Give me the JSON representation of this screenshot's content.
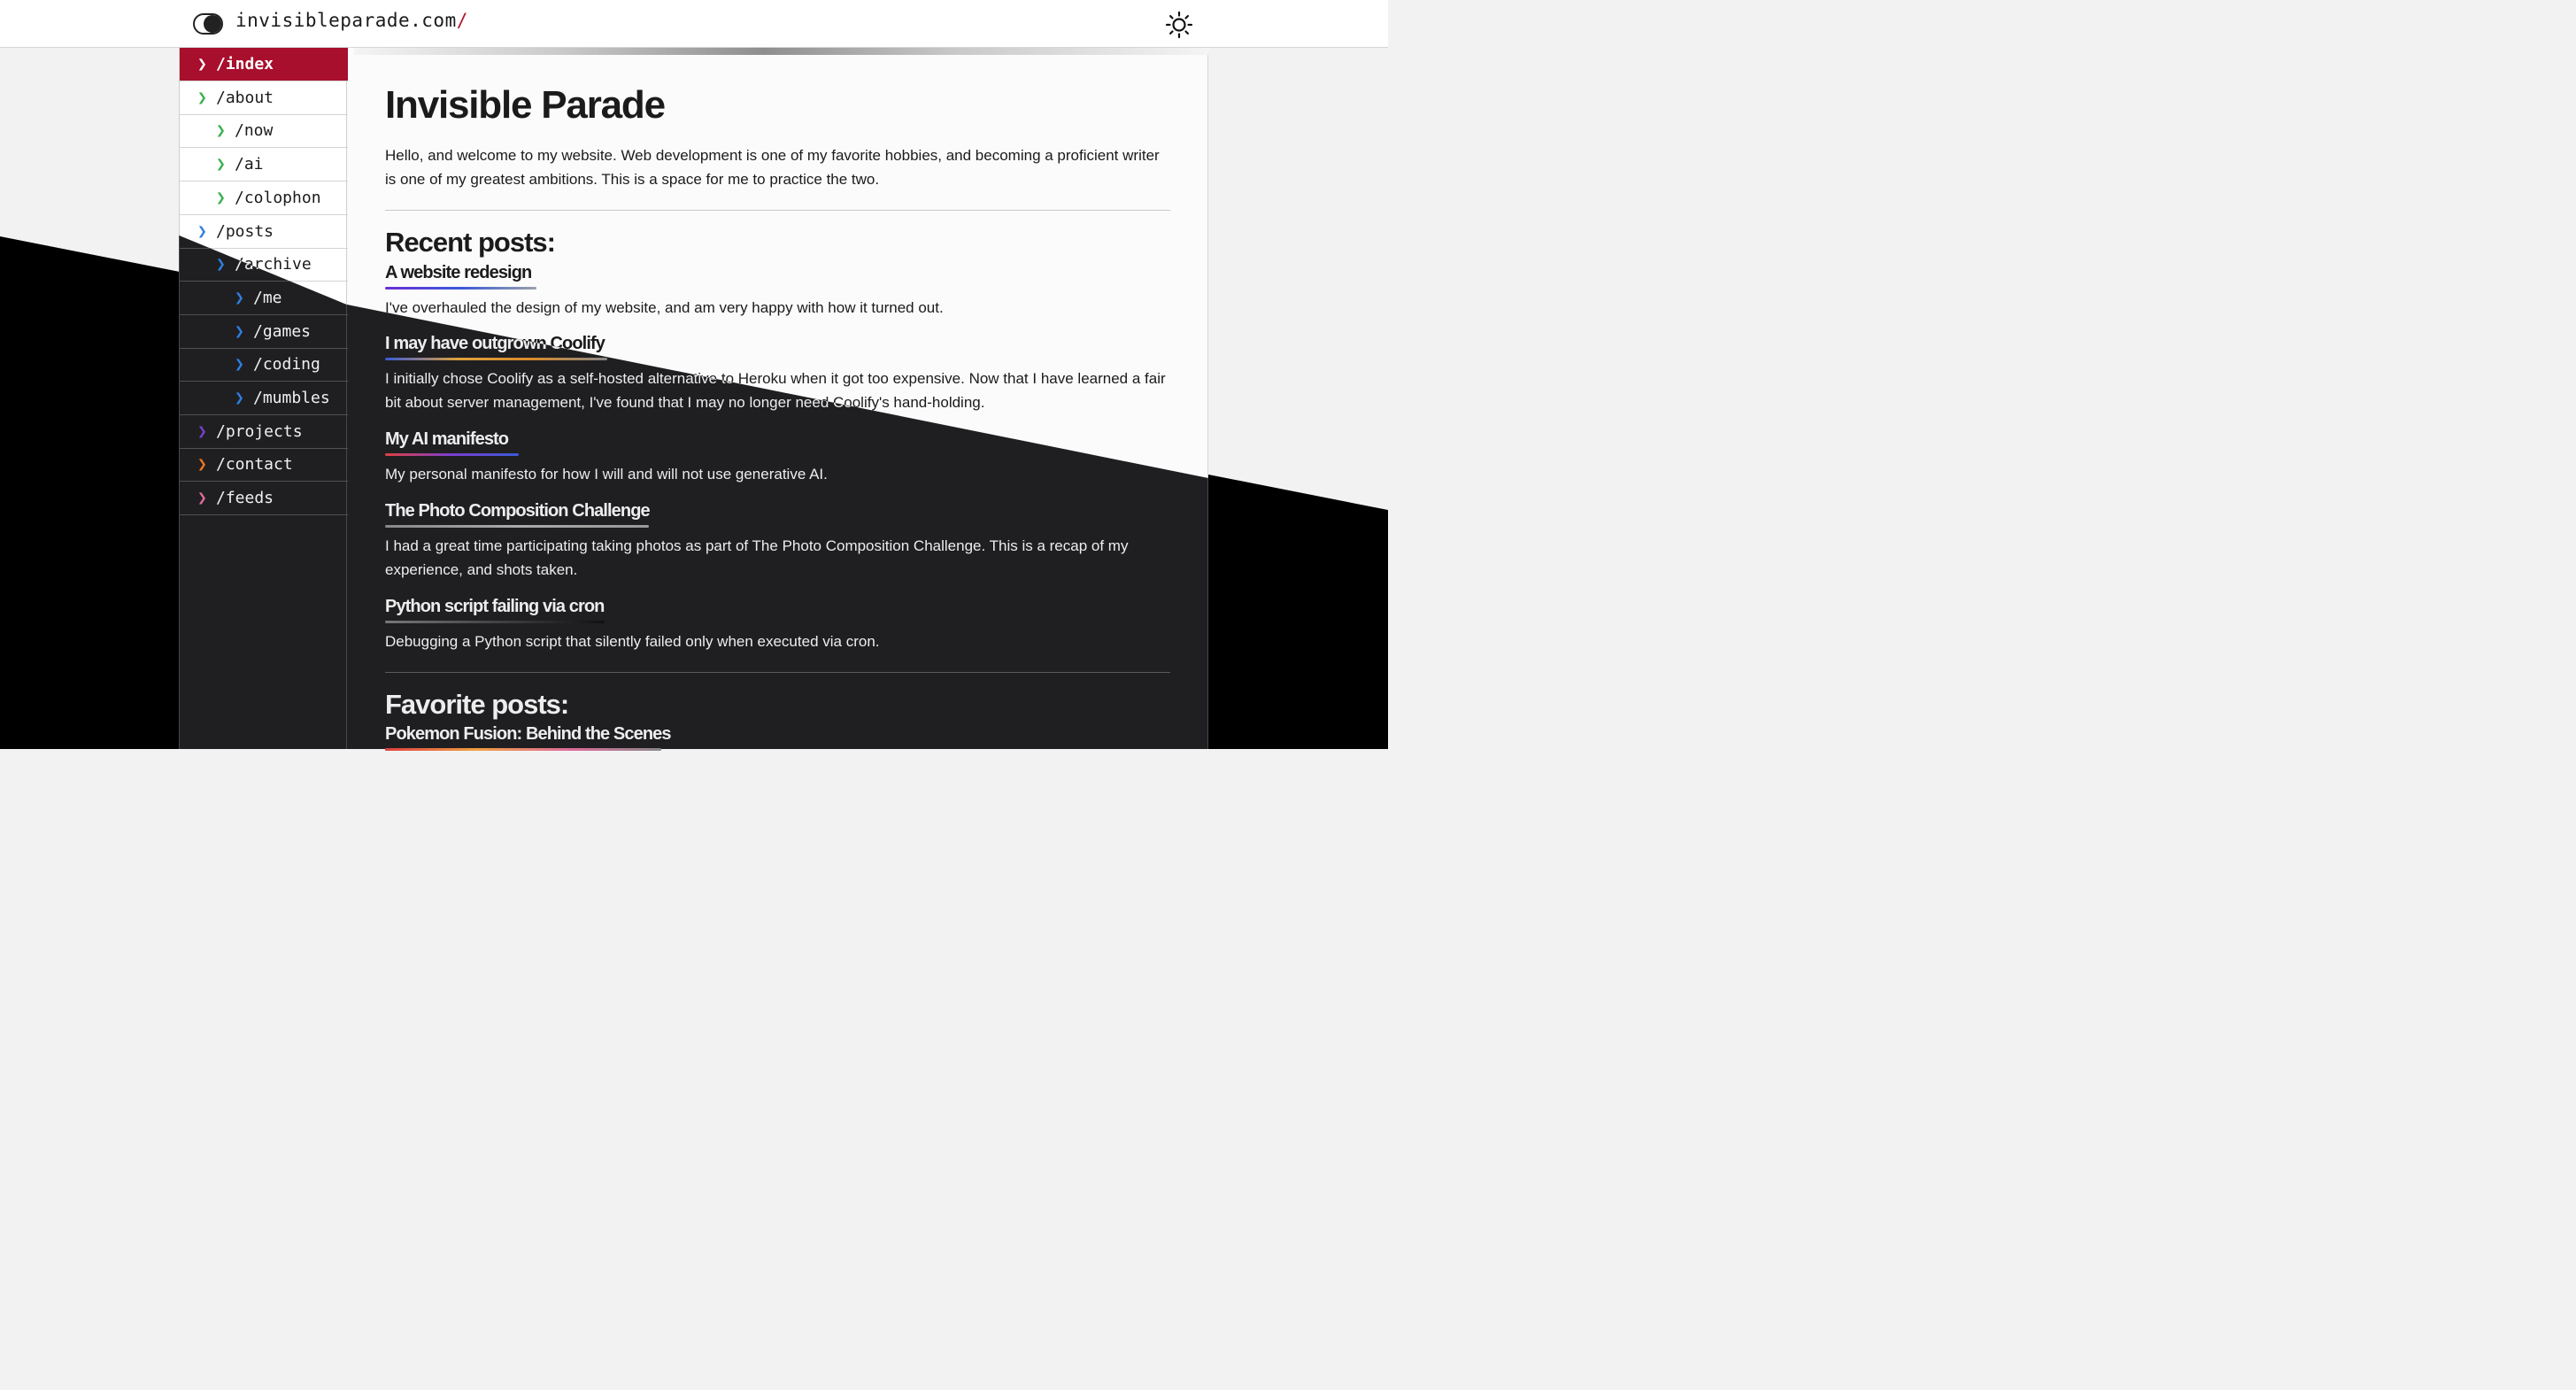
{
  "header": {
    "site_name": "invisibleparade.com",
    "site_slash": "/",
    "toggle_icon": "contrast-toggle-icon",
    "theme_icon": "sun-icon"
  },
  "sidebar": {
    "items": [
      {
        "label": "/index",
        "level": 0,
        "chevron_color": "#ffffff",
        "active": true
      },
      {
        "label": "/about",
        "level": 0,
        "chevron_color": "#3ab04d"
      },
      {
        "label": "/now",
        "level": 1,
        "chevron_color": "#3ab04d"
      },
      {
        "label": "/ai",
        "level": 1,
        "chevron_color": "#3ab04d"
      },
      {
        "label": "/colophon",
        "level": 1,
        "chevron_color": "#3ab04d"
      },
      {
        "label": "/posts",
        "level": 0,
        "chevron_color": "#2f7fe0"
      },
      {
        "label": "/archive",
        "level": 1,
        "chevron_color": "#2f7fe0"
      },
      {
        "label": "/me",
        "level": 2,
        "chevron_color": "#2f7fe0"
      },
      {
        "label": "/games",
        "level": 2,
        "chevron_color": "#2f7fe0"
      },
      {
        "label": "/coding",
        "level": 2,
        "chevron_color": "#2f7fe0"
      },
      {
        "label": "/mumbles",
        "level": 2,
        "chevron_color": "#2f7fe0"
      },
      {
        "label": "/projects",
        "level": 0,
        "chevron_color": "#7a3fd0"
      },
      {
        "label": "/contact",
        "level": 0,
        "chevron_color": "#f0761a"
      },
      {
        "label": "/feeds",
        "level": 0,
        "chevron_color": "#e06a9a"
      }
    ],
    "chevron": "❯"
  },
  "main": {
    "title": "Invisible Parade",
    "intro": "Hello, and welcome to my website. Web development is one of my favorite hobbies, and becoming a proficient writer is one of my greatest ambitions. This is a space for me to practice the two.",
    "recent_heading": "Recent posts:",
    "posts": [
      {
        "title": "A website redesign",
        "desc": "I've overhauled the design of my website, and am very happy with how it turned out."
      },
      {
        "title": "I may have outgrown Coolify",
        "desc": "I initially chose Coolify as a self-hosted alternative to Heroku when it got too expensive. Now that I have learned a fair bit about server management, I've found that I may no longer need Coolify's hand-holding."
      },
      {
        "title": "My AI manifesto",
        "desc": "My personal manifesto for how I will and will not use generative AI."
      },
      {
        "title": "The Photo Composition Challenge",
        "desc": "I had a great time participating taking photos as part of The Photo Composition Challenge. This is a recap of my experience, and shots taken."
      },
      {
        "title": "Python script failing via cron",
        "desc": "Debugging a Python script that silently failed only when executed via cron."
      }
    ],
    "favorite_heading": "Favorite posts:",
    "favorites": [
      {
        "title": "Pokemon Fusion: Behind the Scenes"
      }
    ]
  },
  "colors": {
    "accent": "#a80f2d",
    "dark_bg": "#1f1f22",
    "light_bg": "#fbfbfb"
  }
}
